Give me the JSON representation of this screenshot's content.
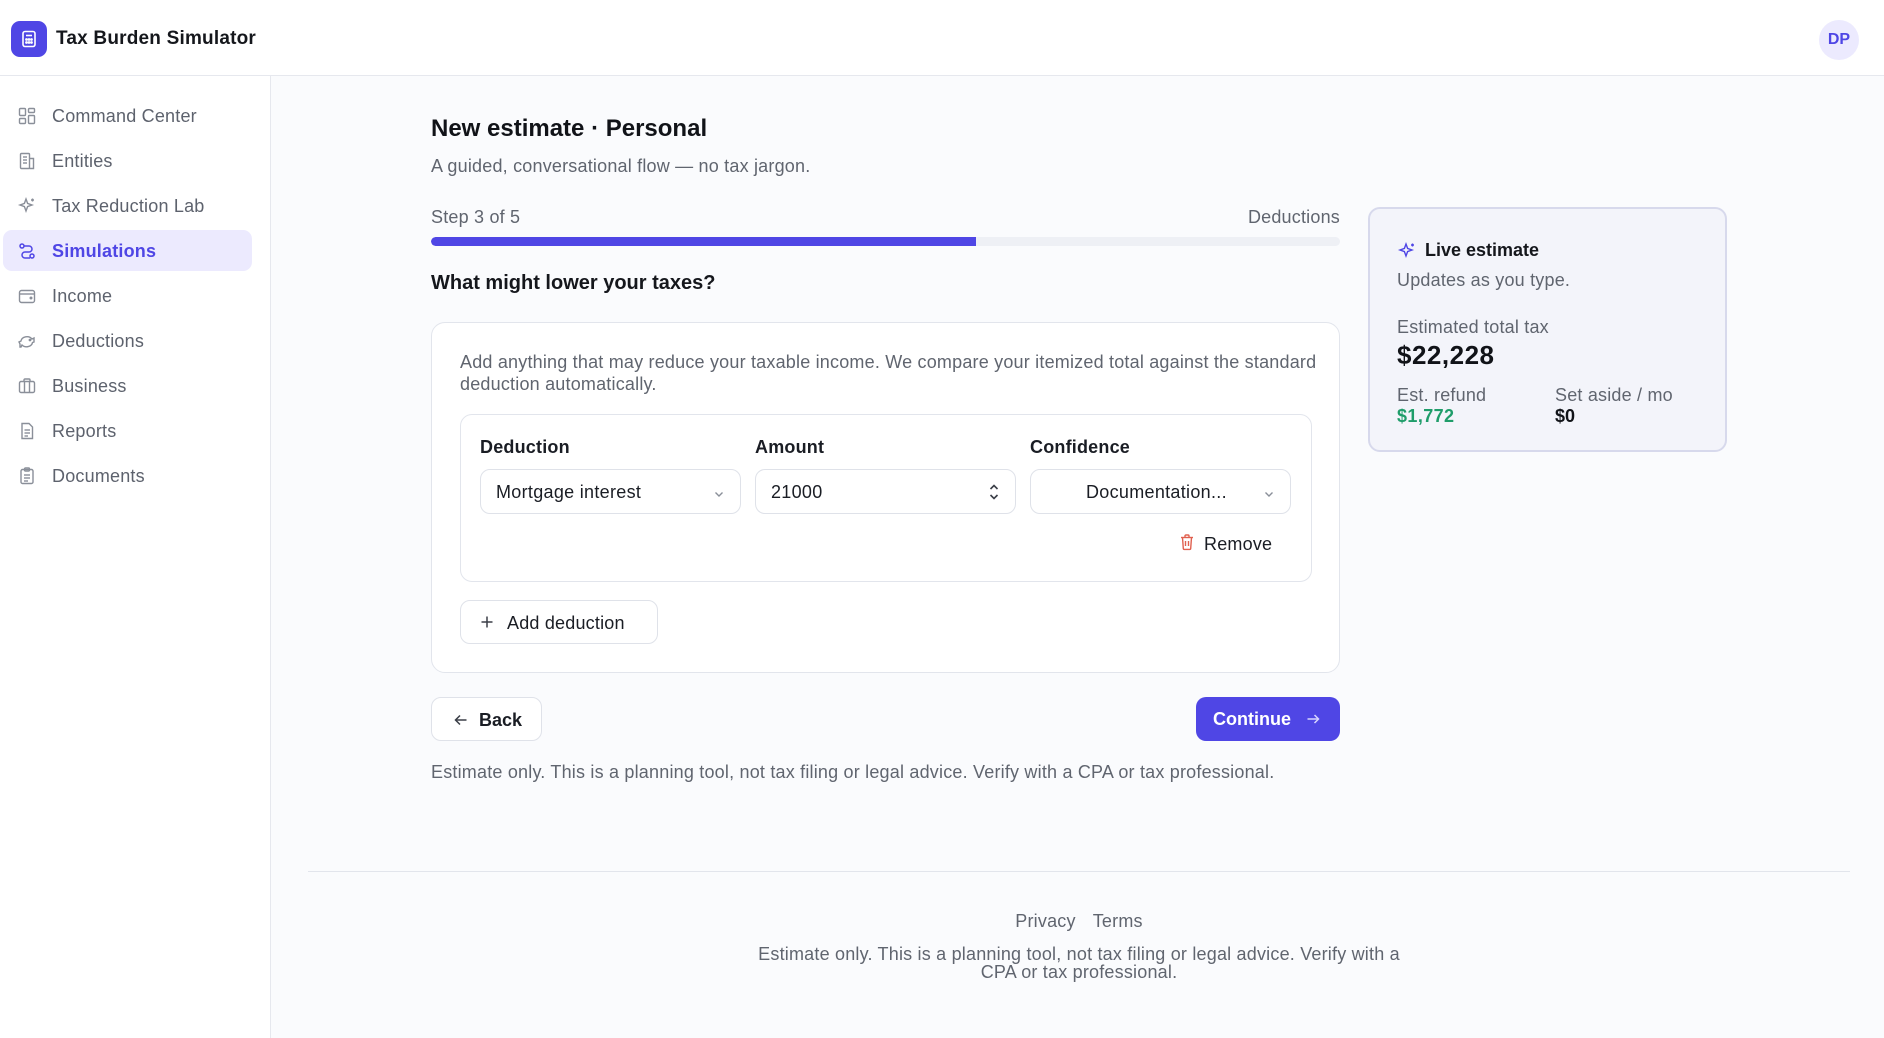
{
  "app": {
    "title": "Tax Burden Simulator",
    "avatar_initials": "DP",
    "logo_icon": "calculator-icon",
    "accent_color": "#4f46e5"
  },
  "sidebar": {
    "items": [
      {
        "label": "Command Center",
        "icon": "dashboard-icon",
        "active": false
      },
      {
        "label": "Entities",
        "icon": "building-icon",
        "active": false
      },
      {
        "label": "Tax Reduction Lab",
        "icon": "sparkles-icon",
        "active": false
      },
      {
        "label": "Simulations",
        "icon": "route-icon",
        "active": true
      },
      {
        "label": "Income",
        "icon": "wallet-icon",
        "active": false
      },
      {
        "label": "Deductions",
        "icon": "piggy-bank-icon",
        "active": false
      },
      {
        "label": "Business",
        "icon": "briefcase-icon",
        "active": false
      },
      {
        "label": "Reports",
        "icon": "report-icon",
        "active": false
      },
      {
        "label": "Documents",
        "icon": "clipboard-icon",
        "active": false
      }
    ]
  },
  "main": {
    "title": "New estimate · Personal",
    "subtitle": "A guided, conversational flow — no tax jargon.",
    "step_label": "Step 3 of 5",
    "step_name": "Deductions",
    "progress_fraction": 0.6,
    "question": "What might lower your taxes?",
    "card": {
      "hint": "Add anything that may reduce your taxable income. We compare your itemized total against the standard deduction automatically.",
      "row": {
        "deduction_label": "Deduction",
        "deduction_value": "Mortgage interest",
        "amount_label": "Amount",
        "amount_value": "21000",
        "confidence_label": "Confidence",
        "confidence_value": "Documentation...",
        "remove_label": "Remove"
      },
      "add_label": "Add deduction"
    },
    "back_label": "Back",
    "continue_label": "Continue",
    "disclaimer": "Estimate only. This is a planning tool, not tax filing or legal advice. Verify with a CPA or tax professional."
  },
  "live_estimate": {
    "title": "Live estimate",
    "subtitle": "Updates as you type.",
    "total_label": "Estimated total tax",
    "total_value": "$22,228",
    "refund_label": "Est. refund",
    "refund_value": "$1,772",
    "aside_label": "Set aside / mo",
    "aside_value": "$0",
    "refund_color": "#1f9d6a"
  },
  "footer": {
    "privacy": "Privacy",
    "terms": "Terms",
    "note": "Estimate only. This is a planning tool, not tax filing or legal advice. Verify with a CPA or tax professional."
  }
}
